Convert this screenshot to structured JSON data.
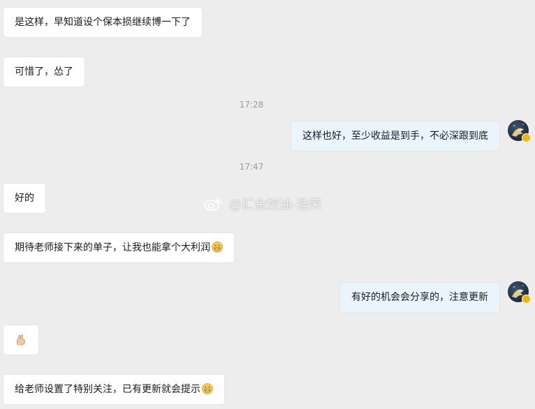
{
  "chat": {
    "messages": [
      {
        "text": "是这样，早知道设个保本损继续博一下了"
      },
      {
        "text": "可惜了，怂了"
      },
      {
        "text": "这样也好，至少收益是到手，不必深跟到底"
      },
      {
        "text": "好的"
      },
      {
        "text": "期待老师接下来的单子，让我也能拿个大利润",
        "emoji": "grin-emoji"
      },
      {
        "text": "有好的机会会分享的，注意更新"
      },
      {
        "icon": "sticker-icon"
      },
      {
        "text": "给老师设置了特别关注，已有更新就会提示",
        "emoji": "grin-emoji"
      }
    ],
    "timestamps": [
      "17:28",
      "17:47"
    ]
  },
  "watermark": {
    "text": "@汇金控油-浩荣",
    "icon": "weibo-icon"
  },
  "colors": {
    "background": "#ededed",
    "incoming_bubble": "#ffffff",
    "outgoing_bubble": "#e9f4fd",
    "timestamp": "#9a9a9a",
    "avatar_badge": "#f2b400"
  }
}
